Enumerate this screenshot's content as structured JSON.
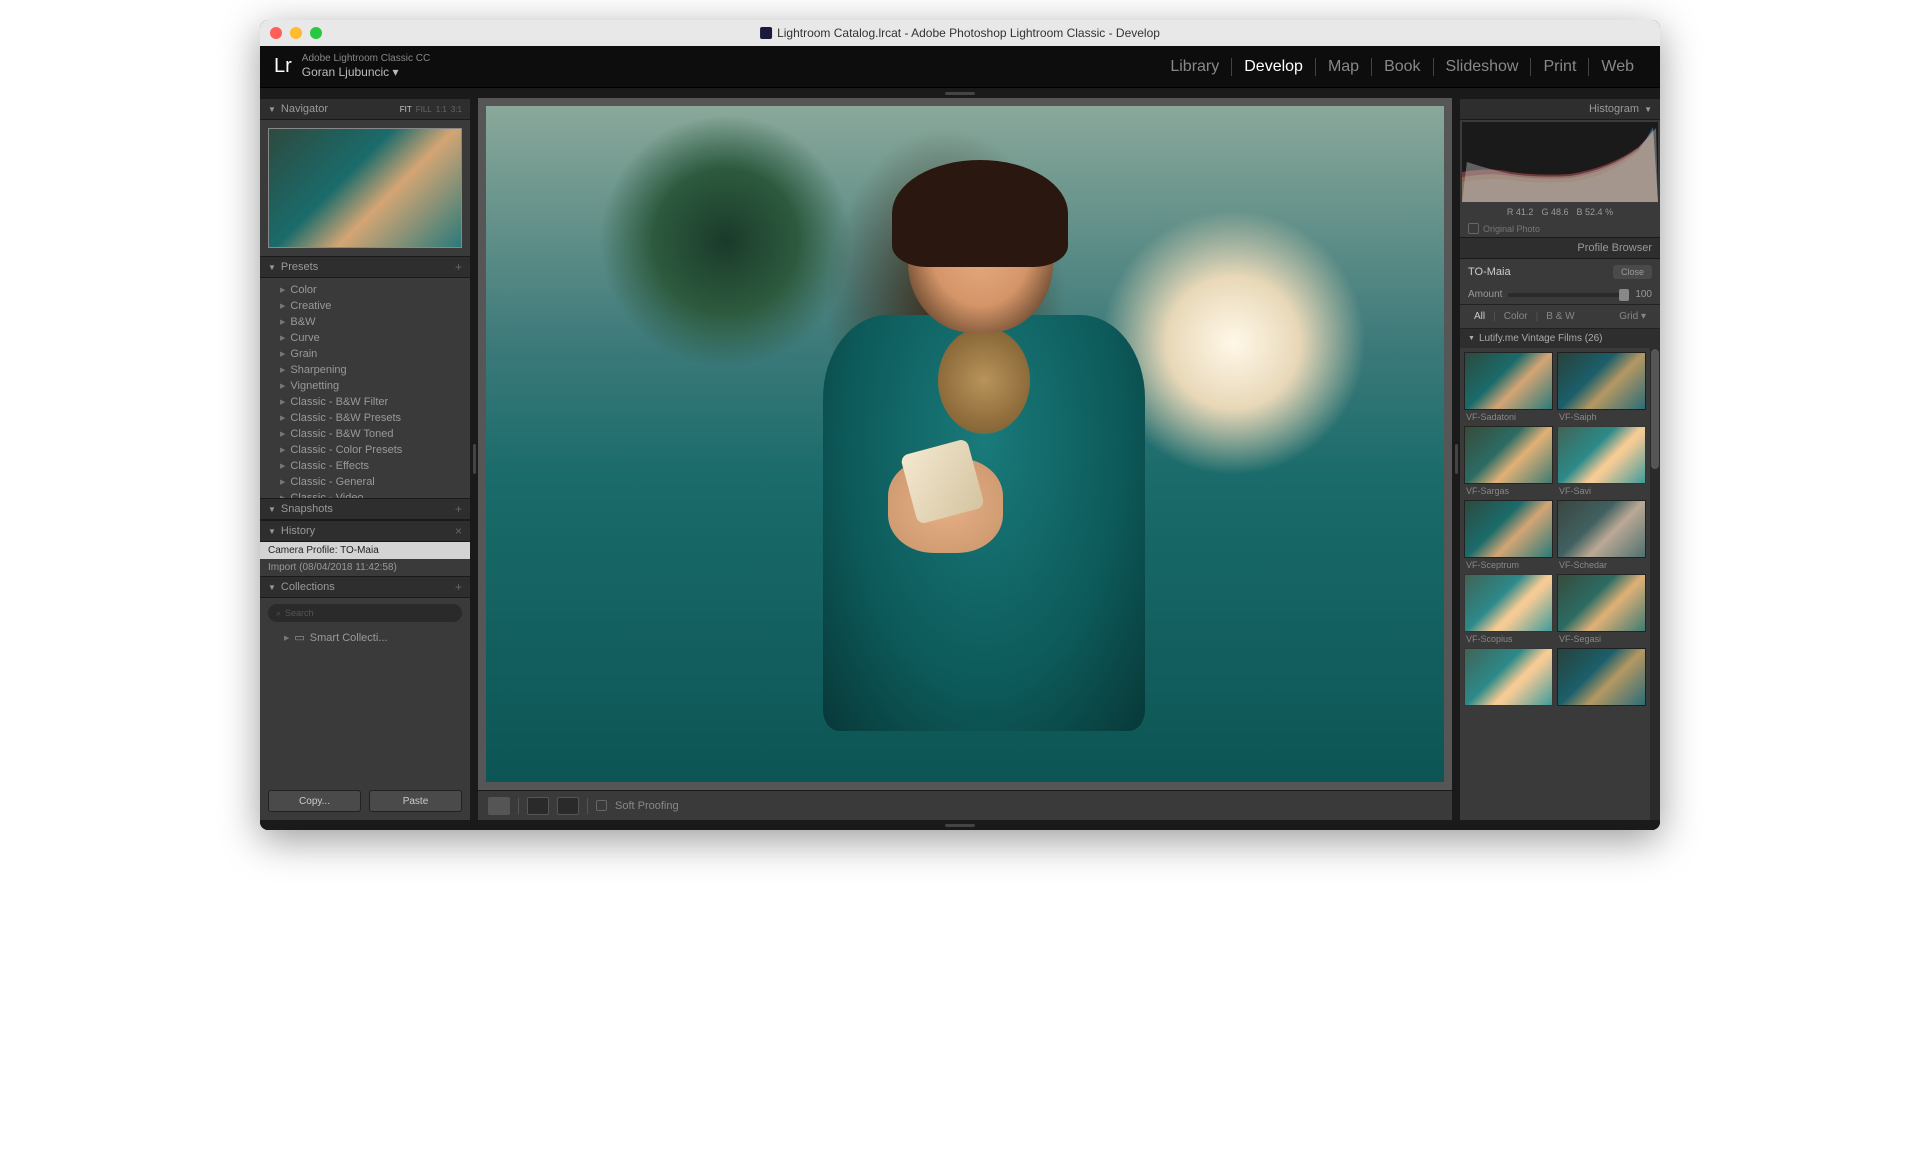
{
  "window_title": "Lightroom Catalog.lrcat - Adobe Photoshop Lightroom Classic - Develop",
  "app": {
    "logo": "Lr",
    "product": "Adobe Lightroom Classic CC",
    "user": "Goran Ljubuncic"
  },
  "modules": [
    "Library",
    "Develop",
    "Map",
    "Book",
    "Slideshow",
    "Print",
    "Web"
  ],
  "active_module": "Develop",
  "navigator": {
    "title": "Navigator",
    "ratios": [
      "FIT",
      "FILL",
      "1:1",
      "3:1"
    ]
  },
  "presets": {
    "title": "Presets",
    "items": [
      "Color",
      "Creative",
      "B&W",
      "Curve",
      "Grain",
      "Sharpening",
      "Vignetting",
      "Classic - B&W Filter",
      "Classic - B&W Presets",
      "Classic - B&W Toned",
      "Classic - Color Presets",
      "Classic - Effects",
      "Classic - General",
      "Classic - Video"
    ]
  },
  "snapshots": {
    "title": "Snapshots"
  },
  "history": {
    "title": "History",
    "items": [
      "Camera Profile: TO-Maia",
      "Import (08/04/2018 11:42:58)"
    ],
    "selected": 0
  },
  "collections": {
    "title": "Collections",
    "search_placeholder": "Search",
    "items": [
      "Smart Collecti..."
    ]
  },
  "buttons": {
    "copy": "Copy...",
    "paste": "Paste"
  },
  "toolbar": {
    "soft_proofing": "Soft Proofing"
  },
  "histogram": {
    "title": "Histogram",
    "readout": {
      "r": "41.2",
      "g": "48.6",
      "b": "52.4",
      "pct": "%"
    },
    "original_photo": "Original Photo"
  },
  "profile_browser": {
    "title": "Profile Browser",
    "current": "TO-Maia",
    "close": "Close",
    "amount_label": "Amount",
    "amount_value": "100",
    "filters": [
      "All",
      "Color",
      "B & W"
    ],
    "view": "Grid",
    "group": "Lutify.me Vintage Films (26)",
    "profiles": [
      "VF-Sadatoni",
      "VF-Saiph",
      "VF-Sargas",
      "VF-Savi",
      "VF-Sceptrum",
      "VF-Schedar",
      "VF-Scopius",
      "VF-Segasi"
    ]
  }
}
